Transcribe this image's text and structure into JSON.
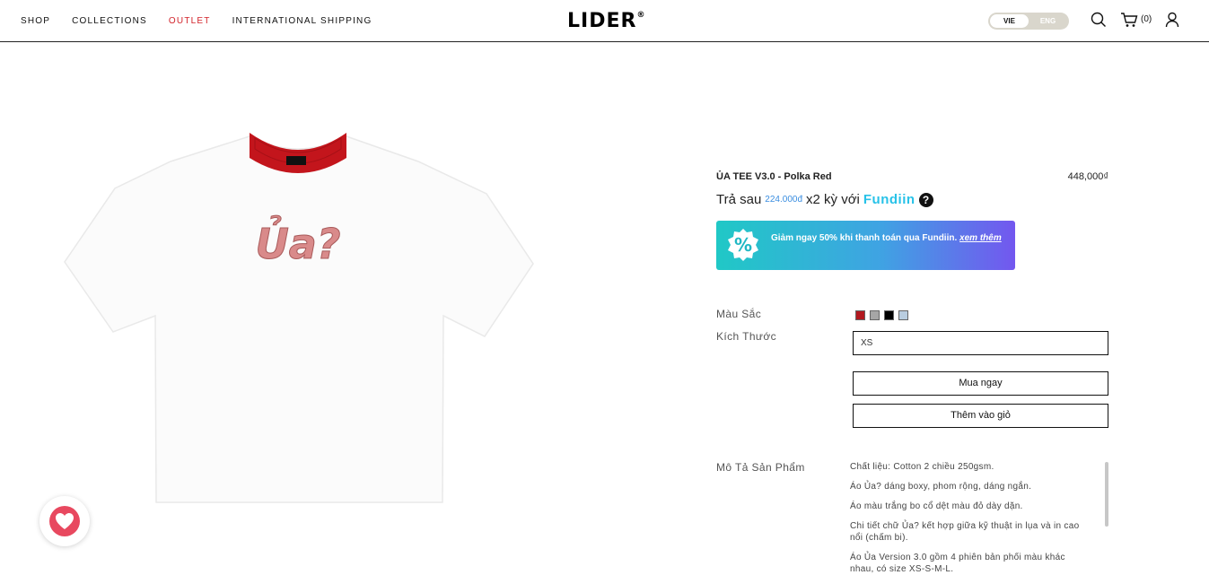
{
  "nav": {
    "items": [
      "SHOP",
      "COLLECTIONS",
      "OUTLET",
      "INTERNATIONAL SHIPPING"
    ]
  },
  "brand": {
    "name": "LIDER",
    "mark": "®"
  },
  "language": {
    "active": "VIE",
    "inactive": "ENG"
  },
  "icons": {
    "search": "search-icon",
    "cart": "cart-icon",
    "account": "user-icon",
    "wishlist": "heart-icon"
  },
  "cart": {
    "count": "(0)"
  },
  "product": {
    "title": "ỦA TEE V3.0 - Polka Red",
    "price": "448,000₫",
    "installment": {
      "prefix": "Trả sau",
      "amount": "224.000đ",
      "suffix": "x2 kỳ với",
      "provider": "Fundiin",
      "help": "?"
    },
    "promo": {
      "badge": "%",
      "text_before": "Giảm ngay ",
      "percent": "50%",
      "text_after": " khi thanh toán qua Fundiin. ",
      "more": "xem thêm"
    },
    "color_label": "Màu Sắc",
    "colors": [
      "#b2191f",
      "#a6a6a6",
      "#000000",
      "#b9cde0"
    ],
    "size_label": "Kích Thước",
    "size_value": "XS",
    "buy_now": "Mua ngay",
    "add_to_cart": "Thêm vào giỏ",
    "description_label": "Mô Tả Sản Phẩm",
    "description": [
      "Chất liệu: Cotton 2 chiều 250gsm.",
      "Áo Ủa? dáng boxy, phom rộng, dáng ngắn.",
      "Áo màu trắng bo cổ dệt màu đỏ dày dặn.",
      "Chi tiết chữ Ủa? kết hợp giữa kỹ thuật in lụa và in cao nổi (chấm bi).",
      "Áo Ủa Version 3.0 gồm 4 phiên bản phối màu khác nhau, có size XS-S-M-L."
    ],
    "image_print": "Ủa?"
  }
}
